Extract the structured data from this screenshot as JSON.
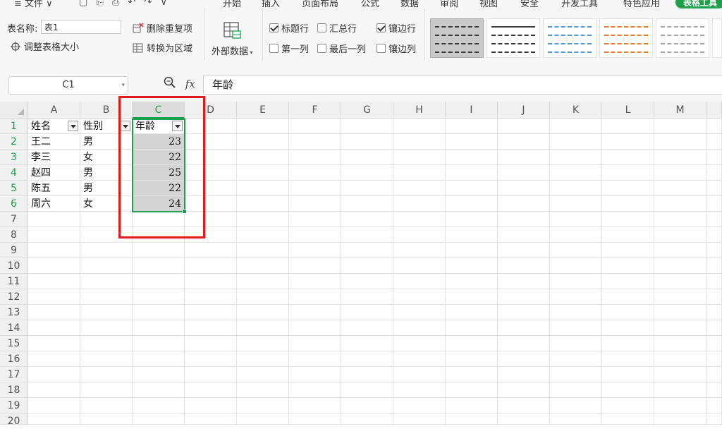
{
  "menubar": {
    "file_label": "≡ 文件 ∨",
    "tabs": [
      "开始",
      "插入",
      "页面布局",
      "公式",
      "数据",
      "审阅",
      "视图",
      "安全",
      "开发工具",
      "特色应用"
    ],
    "tool_tab": "表格工具"
  },
  "ribbon": {
    "table_name_label": "表名称:",
    "table_name_value": "表1",
    "resize_table": "调整表格大小",
    "remove_duplicates": "删除重复项",
    "convert_to_range": "转换为区域",
    "external_data": "外部数据",
    "options": [
      {
        "label": "标题行",
        "checked": true
      },
      {
        "label": "汇总行",
        "checked": false
      },
      {
        "label": "镶边行",
        "checked": true
      },
      {
        "label": "第一列",
        "checked": false
      },
      {
        "label": "最后一列",
        "checked": false
      },
      {
        "label": "镶边列",
        "checked": false
      }
    ],
    "style_colors": [
      "#3a3a3a",
      "#3a3a3a",
      "#5b9bd5",
      "#ed7d31",
      "#a5a5a5",
      "#ffc000"
    ]
  },
  "formula_bar": {
    "name_box": "C1",
    "fx_label": "fx",
    "formula": "年龄"
  },
  "sheet": {
    "columns": [
      "A",
      "B",
      "C",
      "D",
      "E",
      "F",
      "G",
      "H",
      "I",
      "J",
      "K",
      "L",
      "M"
    ],
    "selected_column": "C",
    "row_numbers": [
      "1",
      "2",
      "3",
      "4",
      "5",
      "6",
      "7",
      "8",
      "9",
      "10",
      "11",
      "12",
      "13",
      "14",
      "15",
      "16",
      "17",
      "18",
      "19",
      "20"
    ],
    "header": [
      "姓名",
      "性别",
      "年龄"
    ],
    "rows": [
      [
        "王二",
        "男",
        "23"
      ],
      [
        "李三",
        "女",
        "22"
      ],
      [
        "赵四",
        "男",
        "25"
      ],
      [
        "陈五",
        "男",
        "22"
      ],
      [
        "周六",
        "女",
        "24"
      ]
    ]
  },
  "colors": {
    "accent": "#1e9f4c",
    "highlight": "#e01b1b"
  }
}
